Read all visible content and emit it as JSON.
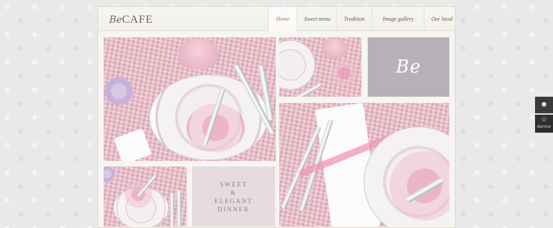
{
  "header": {
    "logo": {
      "prefix": "Be",
      "name": "CAFE"
    },
    "nav": [
      {
        "label": "Home",
        "active": true
      },
      {
        "label": "Sweet menu",
        "active": false
      },
      {
        "label": "Tradition",
        "active": false
      },
      {
        "label": "Image gallery",
        "active": false
      },
      {
        "label": "Our local",
        "active": false
      }
    ]
  },
  "tiles": {
    "be_tile": {
      "text": "Be",
      "color": "#b6b1b8"
    },
    "sweet_tile": {
      "lines": [
        "SWEET",
        "&",
        "ELEGANT",
        "DINNER"
      ],
      "color": "#e7dbdf"
    }
  },
  "side_widget": {
    "top_icon": "gear-icon",
    "bottom_icon": "star-icon",
    "bottom_label": "demos"
  }
}
